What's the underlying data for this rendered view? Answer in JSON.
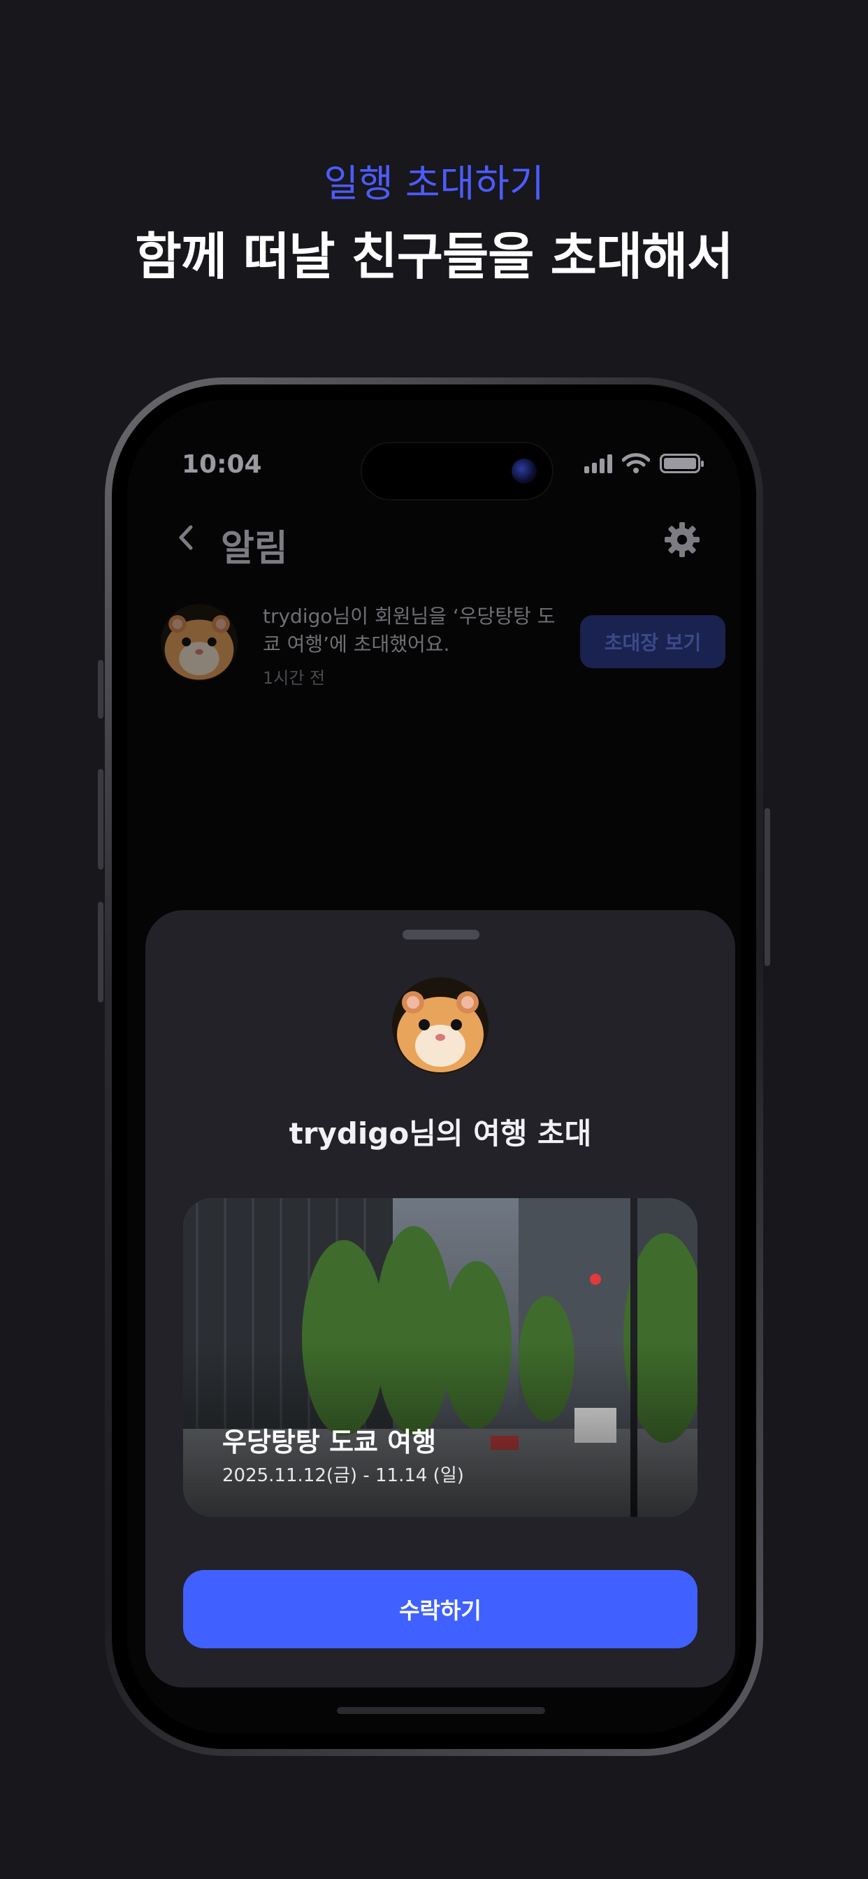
{
  "hero": {
    "subtitle": "일행 초대하기",
    "title": "함께 떠날 친구들을 초대해서"
  },
  "status_bar": {
    "time": "10:04"
  },
  "header": {
    "title": "알림",
    "back_icon": "chevron-left-icon",
    "settings_icon": "gear-icon"
  },
  "notification": {
    "message": "trydigo님이 회원님을 ‘우당탕탕 도쿄 여행’에 초대했어요.",
    "time": "1시간 전",
    "button_label": "초대장 보기"
  },
  "invite_sheet": {
    "title": "trydigo님의 여행 초대",
    "trip_name": "우당탕탕 도쿄 여행",
    "trip_dates": "2025.11.12(금) - 11.14 (일)",
    "accept_label": "수락하기"
  },
  "colors": {
    "background": "#17171c",
    "accent": "#4d5bff",
    "button": "#4061ff",
    "sheet": "#222228"
  }
}
